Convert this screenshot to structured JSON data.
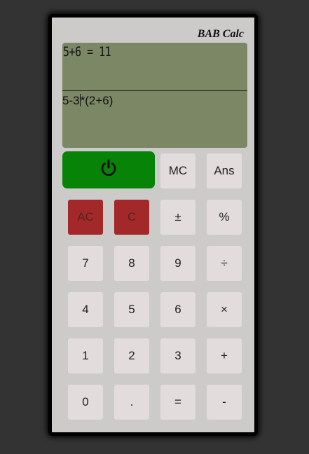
{
  "app": {
    "brand": "BAB Calc"
  },
  "display": {
    "result": "5+6 = 11",
    "expression_before_caret": "5-3",
    "expression_after_caret": "*(2+6)"
  },
  "buttons": {
    "mc": "MC",
    "ans": "Ans",
    "ac": "AC",
    "c": "C",
    "plus_minus": "±",
    "percent": "%",
    "seven": "7",
    "eight": "8",
    "nine": "9",
    "divide": "÷",
    "four": "4",
    "five": "5",
    "six": "6",
    "multiply": "×",
    "one": "1",
    "two": "2",
    "three": "3",
    "plus": "+",
    "zero": "0",
    "dot": ".",
    "equals": "=",
    "minus": "-"
  },
  "icons": {
    "power": "power-icon"
  },
  "colors": {
    "display_bg": "#7c8766",
    "power_button": "#078407",
    "clear_buttons": "#a3282a",
    "key_bg": "#e2dcdc",
    "body_bg": "#cdcbca"
  }
}
